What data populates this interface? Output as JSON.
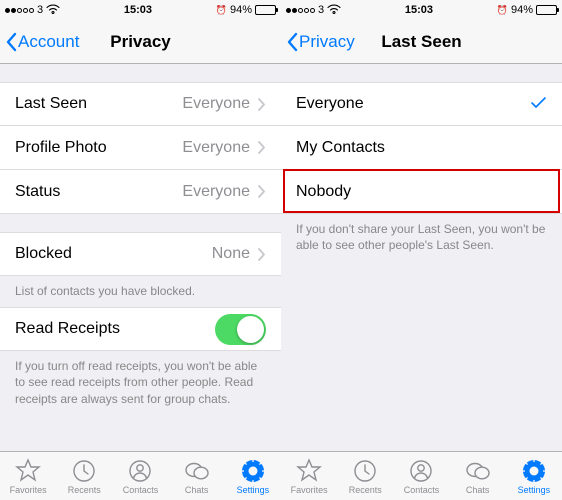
{
  "status": {
    "carrier": "3",
    "time": "15:03",
    "battery_pct": "94%",
    "battery_fill": 94
  },
  "left": {
    "nav_back": "Account",
    "nav_title": "Privacy",
    "rows": {
      "last_seen": {
        "label": "Last Seen",
        "value": "Everyone"
      },
      "profile_photo": {
        "label": "Profile Photo",
        "value": "Everyone"
      },
      "status": {
        "label": "Status",
        "value": "Everyone"
      },
      "blocked": {
        "label": "Blocked",
        "value": "None"
      },
      "read_receipts": {
        "label": "Read Receipts"
      }
    },
    "blocked_footer": "List of contacts you have blocked.",
    "receipts_footer": "If you turn off read receipts, you won't be able to see read receipts from other people. Read receipts are always sent for group chats."
  },
  "right": {
    "nav_back": "Privacy",
    "nav_title": "Last Seen",
    "options": {
      "everyone": "Everyone",
      "my_contacts": "My Contacts",
      "nobody": "Nobody"
    },
    "footer": "If you don't share your Last Seen, you won't be able to see other people's Last Seen."
  },
  "tabs": {
    "favorites": "Favorites",
    "recents": "Recents",
    "contacts": "Contacts",
    "chats": "Chats",
    "settings": "Settings"
  }
}
